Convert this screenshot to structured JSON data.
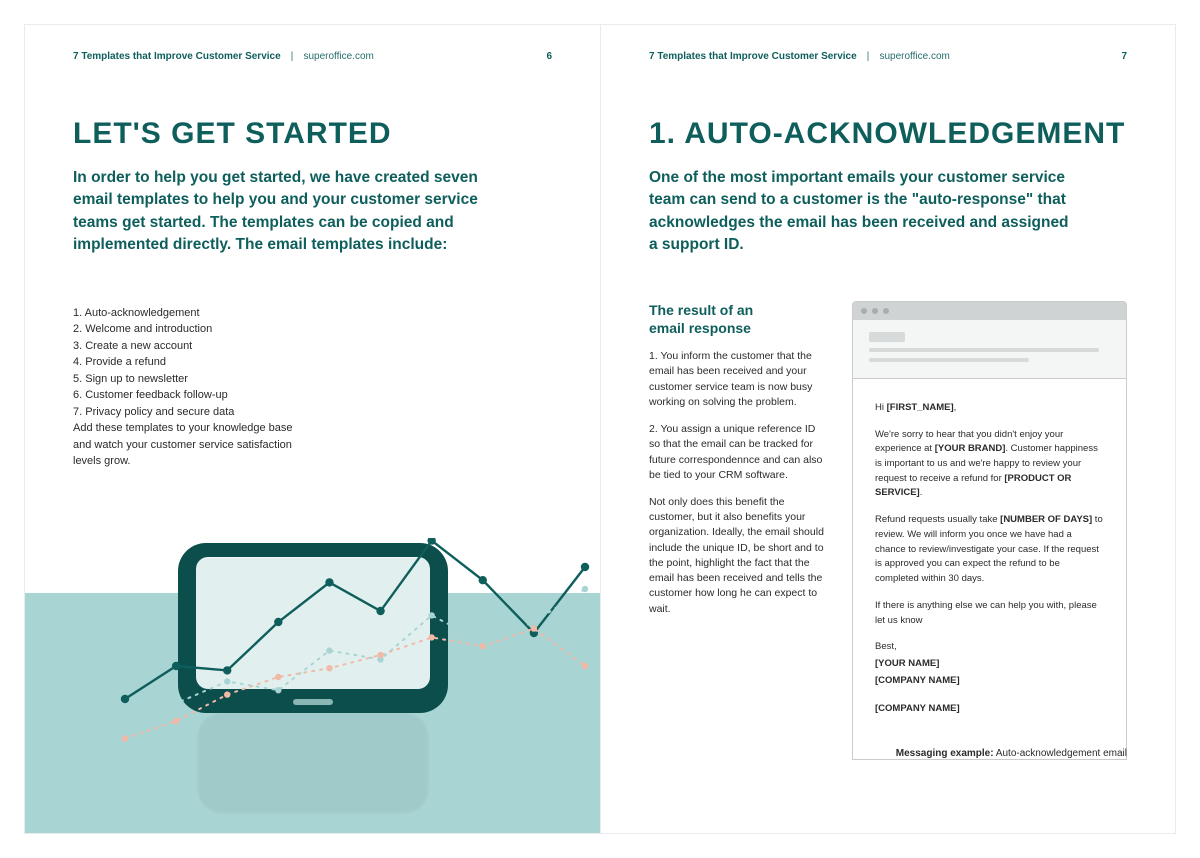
{
  "header": {
    "doc_title": "7 Templates that Improve Customer Service",
    "site": "superoffice.com",
    "separator": "|"
  },
  "page_numbers": {
    "left": "6",
    "right": "7"
  },
  "left": {
    "title": "LET'S GET STARTED",
    "intro": "In order to help you get started, we have created seven email templates to help you and your customer service teams get started. The templates can be copied and implemented directly. The email templates include:",
    "templates": [
      "1. Auto-acknowledgement",
      "2. Welcome and introduction",
      "3. Create a new account",
      "4. Provide a refund",
      "5. Sign up to newsletter",
      "6. Customer feedback follow-up",
      "7. Privacy policy and secure data"
    ],
    "after_list": "Add these templates to your knowledge base and watch your customer service satisfaction levels grow."
  },
  "right": {
    "title": "1. AUTO-ACKNOWLEDGEMENT",
    "intro": "One of the most important emails your customer service team can send to a customer is the \"auto-response\" that acknowledges the email has been received and assigned a support ID.",
    "section_heading_l1": "The result of an",
    "section_heading_l2": "email response",
    "para1": "1. You inform the customer that the email has been received and your customer service team is now busy working on solving the problem.",
    "para2": "2. You assign a unique reference ID so that the email can be tracked for future correspondennce and can also be tied to your CRM software.",
    "para3": "Not only does this benefit the customer, but it also benefits your organization. Ideally, the email should include the unique ID, be short and to the point, highlight the fact that the email has been received and tells the customer how long he can expect to wait.",
    "email": {
      "greeting_pre": "Hi ",
      "greeting_name": "[FIRST_NAME]",
      "greeting_post": ",",
      "p1_a": "We're sorry to hear that you didn't enjoy your experience at ",
      "p1_brand": "[YOUR BRAND]",
      "p1_b": ". Customer happiness is important to us and we're happy to review your request to receive a refund for ",
      "p1_prod": "[PRODUCT OR SERVICE]",
      "p1_c": ".",
      "p2_a": "Refund requests usually take ",
      "p2_days": "[NUMBER OF DAYS]",
      "p2_b": " to review. We will inform you once we have had a chance to review/investigate your case. If the request is approved you can expect the refund to be completed within 30 days.",
      "p3": "If there is anything else we can help you with, please let us know",
      "sig_best": "Best,",
      "sig_name": "[YOUR NAME]",
      "sig_company": "[COMPANY NAME]",
      "sig_company2": "[COMPANY NAME]"
    },
    "caption_label": "Messaging example:",
    "caption_text": " Auto-acknowledgement email"
  },
  "chart_data": {
    "type": "line",
    "title": "",
    "xlabel": "",
    "ylabel": "",
    "x": [
      0,
      1,
      2,
      3,
      4,
      5,
      6,
      7,
      8,
      9
    ],
    "series": [
      {
        "name": "solid-teal",
        "values": [
          0.2,
          0.35,
          0.33,
          0.55,
          0.73,
          0.6,
          0.92,
          0.74,
          0.5,
          0.8
        ],
        "style": "solid",
        "color": "#0e5e5c"
      },
      {
        "name": "dotted-teal",
        "values": [
          0.05,
          0.18,
          0.28,
          0.24,
          0.42,
          0.38,
          0.58,
          0.46,
          0.55,
          0.7
        ],
        "style": "dotted",
        "color": "#a9d4d4"
      },
      {
        "name": "dotted-peach",
        "values": [
          0.02,
          0.1,
          0.22,
          0.3,
          0.34,
          0.4,
          0.48,
          0.44,
          0.52,
          0.35
        ],
        "style": "dotted",
        "color": "#f1b9a8"
      }
    ],
    "ylim": [
      0,
      1
    ]
  }
}
